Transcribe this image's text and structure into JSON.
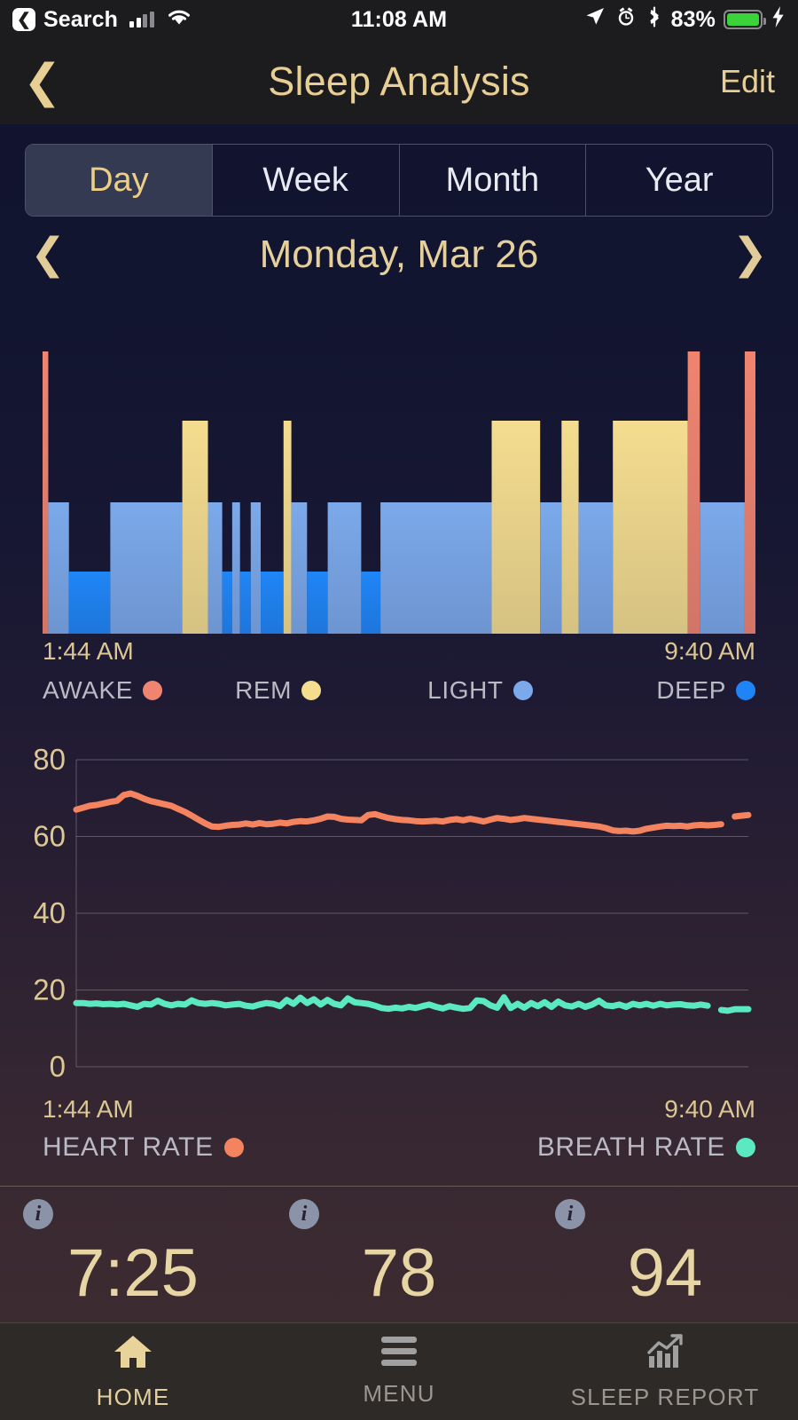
{
  "status_bar": {
    "back_label": "Search",
    "back_icon": "chevron-left-boxed-icon",
    "signal_icon": "cellular-signal-icon",
    "wifi_icon": "wifi-icon",
    "time": "11:08 AM",
    "location_icon": "location-arrow-icon",
    "alarm_icon": "alarm-clock-icon",
    "bluetooth_icon": "bluetooth-icon",
    "battery_percent": "83%",
    "battery_icon": "battery-icon",
    "charging_icon": "lightning-bolt-icon",
    "battery_color": "#3ad43a"
  },
  "nav_bar": {
    "back_icon": "chevron-left-icon",
    "title": "Sleep Analysis",
    "edit_label": "Edit",
    "accent_color": "#e7cf93"
  },
  "segmented_control": {
    "selected": "Day",
    "options": [
      "Day",
      "Week",
      "Month",
      "Year"
    ],
    "active_bg": "#333a52",
    "active_text": "#ecce85"
  },
  "date_nav": {
    "prev_icon": "chevron-left-icon",
    "next_icon": "chevron-right-icon",
    "label": "Monday, Mar 26"
  },
  "hypnogram": {
    "start_time": "1:44 AM",
    "end_time": "9:40 AM",
    "legend": [
      {
        "label": "AWAKE",
        "color": "#ef8470",
        "icon": "legend-dot-awake"
      },
      {
        "label": "REM",
        "color": "#f4dd8f",
        "icon": "legend-dot-rem"
      },
      {
        "label": "LIGHT",
        "color": "#7ba9ea",
        "icon": "legend-dot-light"
      },
      {
        "label": "DEEP",
        "color": "#1f85f6",
        "icon": "legend-dot-deep"
      }
    ]
  },
  "vitals": {
    "start_time": "1:44 AM",
    "end_time": "9:40 AM",
    "legend": [
      {
        "label": "HEART RATE",
        "color": "#f4835f",
        "icon": "legend-dot-heart-rate"
      },
      {
        "label": "BREATH RATE",
        "color": "#5ae9c0",
        "icon": "legend-dot-breath-rate"
      }
    ]
  },
  "stats": [
    {
      "info_icon": "info-icon",
      "value": "7:25"
    },
    {
      "info_icon": "info-icon",
      "value": "78"
    },
    {
      "info_icon": "info-icon",
      "value": "94"
    }
  ],
  "tab_bar": {
    "active": "HOME",
    "tabs": [
      {
        "label": "HOME",
        "icon": "home-icon"
      },
      {
        "label": "MENU",
        "icon": "hamburger-menu-icon"
      },
      {
        "label": "SLEEP REPORT",
        "icon": "chart-trend-icon"
      }
    ]
  },
  "chart_data": [
    {
      "type": "bar",
      "name": "sleep-stage-hypnogram",
      "title": "",
      "xlabel": "",
      "ylabel": "",
      "x_axis_range": [
        "1:44 AM",
        "9:40 AM"
      ],
      "grid": false,
      "legend_position": "below",
      "stage_levels": {
        "AWAKE": 4,
        "REM": 3,
        "LIGHT": 2,
        "DEEP": 1
      },
      "stage_colors": {
        "AWAKE": "#ef8470",
        "REM": "#f4dd8f",
        "LIGHT": "#7ba9ea",
        "DEEP": "#1f85f6"
      },
      "segments": [
        {
          "stage": "AWAKE",
          "start": 0.0,
          "end": 0.008
        },
        {
          "stage": "LIGHT",
          "start": 0.008,
          "end": 0.037
        },
        {
          "stage": "DEEP",
          "start": 0.037,
          "end": 0.095
        },
        {
          "stage": "LIGHT",
          "start": 0.095,
          "end": 0.196
        },
        {
          "stage": "REM",
          "start": 0.196,
          "end": 0.232
        },
        {
          "stage": "LIGHT",
          "start": 0.232,
          "end": 0.252
        },
        {
          "stage": "DEEP",
          "start": 0.252,
          "end": 0.266
        },
        {
          "stage": "LIGHT",
          "start": 0.266,
          "end": 0.277
        },
        {
          "stage": "DEEP",
          "start": 0.277,
          "end": 0.292
        },
        {
          "stage": "LIGHT",
          "start": 0.292,
          "end": 0.306
        },
        {
          "stage": "DEEP",
          "start": 0.306,
          "end": 0.338
        },
        {
          "stage": "REM",
          "start": 0.338,
          "end": 0.349
        },
        {
          "stage": "LIGHT",
          "start": 0.349,
          "end": 0.371
        },
        {
          "stage": "DEEP",
          "start": 0.371,
          "end": 0.4
        },
        {
          "stage": "LIGHT",
          "start": 0.4,
          "end": 0.447
        },
        {
          "stage": "DEEP",
          "start": 0.447,
          "end": 0.474
        },
        {
          "stage": "LIGHT",
          "start": 0.474,
          "end": 0.63
        },
        {
          "stage": "REM",
          "start": 0.63,
          "end": 0.698
        },
        {
          "stage": "LIGHT",
          "start": 0.698,
          "end": 0.728
        },
        {
          "stage": "REM",
          "start": 0.728,
          "end": 0.752
        },
        {
          "stage": "LIGHT",
          "start": 0.752,
          "end": 0.8
        },
        {
          "stage": "REM",
          "start": 0.8,
          "end": 0.905
        },
        {
          "stage": "AWAKE",
          "start": 0.905,
          "end": 0.922
        },
        {
          "stage": "LIGHT",
          "start": 0.922,
          "end": 0.985
        },
        {
          "stage": "AWAKE",
          "start": 0.985,
          "end": 1.0
        }
      ]
    },
    {
      "type": "line",
      "name": "heart-and-breath-rate",
      "title": "",
      "xlabel": "",
      "ylabel": "",
      "ylim": [
        0,
        80
      ],
      "yticks": [
        0,
        20,
        40,
        60,
        80
      ],
      "x_axis_range": [
        "1:44 AM",
        "9:40 AM"
      ],
      "grid": true,
      "legend_position": "below",
      "series": [
        {
          "name": "HEART RATE",
          "color": "#f4835f",
          "values": [
            67,
            67.5,
            68,
            68.2,
            68.6,
            69,
            69.3,
            70.8,
            71.2,
            70.6,
            69.8,
            69.2,
            68.8,
            68.4,
            68,
            67.2,
            66.4,
            65.4,
            64.4,
            63.4,
            62.6,
            62.5,
            62.8,
            63,
            63.1,
            63.4,
            63.1,
            63.5,
            63.2,
            63.3,
            63.6,
            63.4,
            63.8,
            64,
            63.9,
            64.2,
            64.6,
            65.2,
            65.1,
            64.6,
            64.4,
            64.3,
            64.2,
            65.6,
            65.8,
            65.3,
            64.8,
            64.5,
            64.3,
            64.2,
            64,
            63.9,
            64,
            64.1,
            63.9,
            64.3,
            64.5,
            64.2,
            64.6,
            64.3,
            63.9,
            64.4,
            64.8,
            64.6,
            64.3,
            64.5,
            64.8,
            64.6,
            64.4,
            64.2,
            64,
            63.8,
            63.6,
            63.4,
            63.2,
            63,
            62.8,
            62.6,
            62.2,
            61.6,
            61.4,
            61.5,
            61.3,
            61.5,
            62,
            62.3,
            62.6,
            62.8,
            62.7,
            62.8,
            62.6,
            62.9,
            63,
            62.9,
            63,
            63.2,
            null,
            65.2,
            65.4,
            65.6
          ]
        },
        {
          "name": "BREATH RATE",
          "color": "#5ae9c0",
          "values": [
            16.6,
            16.6,
            16.4,
            16.5,
            16.3,
            16.4,
            16.2,
            16.4,
            16,
            15.6,
            16.4,
            16.2,
            17.2,
            16.4,
            16,
            16.4,
            16.2,
            17.3,
            16.6,
            16.4,
            16.6,
            16.4,
            16,
            16.2,
            16.4,
            15.9,
            15.7,
            16.2,
            16.6,
            16.4,
            15.8,
            17.4,
            16.4,
            18,
            16.6,
            17.6,
            16.2,
            17.4,
            16.4,
            16,
            17.8,
            16.8,
            16.6,
            16.4,
            15.9,
            15.3,
            15.1,
            15.4,
            15.2,
            15.6,
            15.3,
            15.8,
            16.2,
            15.6,
            15.2,
            15.8,
            15.4,
            15.1,
            15.3,
            17.3,
            17.1,
            16,
            15.4,
            18.1,
            15.3,
            16.4,
            15.4,
            16.6,
            15.8,
            16.8,
            15.6,
            17,
            16,
            15.7,
            16.4,
            15.6,
            16.2,
            17.2,
            16,
            15.8,
            16.2,
            15.6,
            16.4,
            16,
            16.4,
            15.9,
            16.4,
            16,
            16.2,
            16.3,
            16,
            15.9,
            16.2,
            15.9,
            null,
            14.8,
            14.6,
            15,
            15,
            15
          ]
        }
      ]
    }
  ]
}
